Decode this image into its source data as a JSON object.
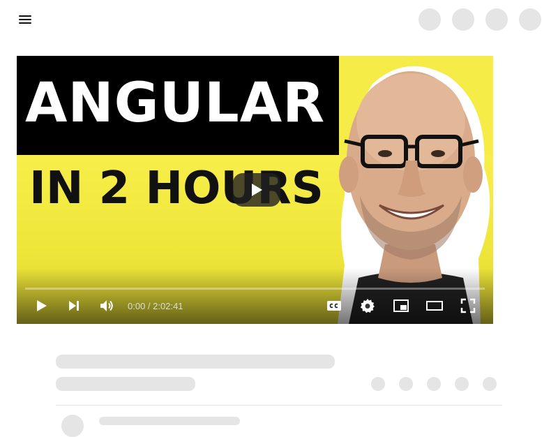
{
  "player": {
    "thumbnail": {
      "title_line1": "ANGULAR",
      "title_line2": "IN 2 HOURS"
    },
    "progress": 0,
    "time": {
      "current": "0:00",
      "separator": " / ",
      "duration": "2:02:41"
    },
    "controls": [
      "play-icon",
      "next-icon",
      "volume-icon",
      "captions-icon",
      "settings-icon",
      "miniplayer-icon",
      "theater-mode-icon",
      "fullscreen-icon"
    ]
  },
  "colors": {
    "thumbnail_yellow": "#f4ea45",
    "thumbnail_black": "#000000",
    "skeleton_gray": "#e5e5e5"
  }
}
